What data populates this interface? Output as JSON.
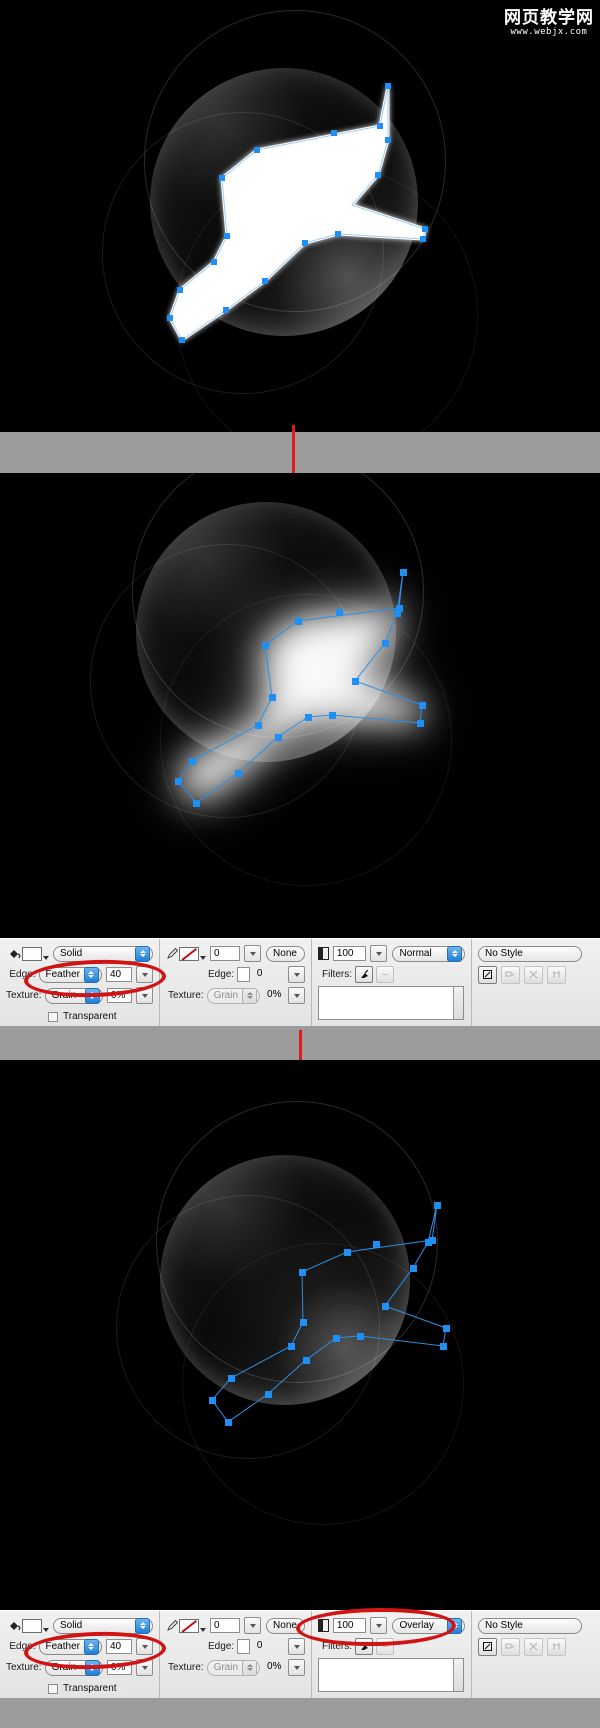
{
  "watermark": {
    "cn_text": "网页教学网",
    "url_text": "www.webjx.com"
  },
  "panels": {
    "step1": {
      "name": "sharp-vector-shape-on-sphere",
      "description": "White filled vector bird shape with blue anchor points over dark glossy sphere"
    },
    "step2": {
      "name": "feathered-shape-on-sphere",
      "description": "Same shape after 40 px feather edge applied"
    },
    "step3": {
      "name": "overlay-blend-shape-on-sphere",
      "description": "Shape set to Overlay blend mode at 100 opacity"
    }
  },
  "arrows": {
    "label": "down-arrow",
    "color": "#e01b1b"
  },
  "inspector_top": {
    "fill": {
      "color_swatch_label": "",
      "fill_type": "Solid",
      "edge_label": "Edge:",
      "edge_type": "Feather",
      "edge_amount": "40",
      "texture_label": "Texture:",
      "texture_type": "Grain",
      "texture_amount": "0%",
      "transparent_label": "Transparent"
    },
    "stroke": {
      "stroke_width": "0",
      "stroke_category": "None",
      "edge_label": "Edge:",
      "edge_amount": "0",
      "texture_label": "Texture:",
      "texture_type": "Grain",
      "texture_amount": "0%"
    },
    "effects": {
      "opacity": "100",
      "blend_mode": "Normal",
      "filters_label": "Filters:",
      "add_filter": "+",
      "remove_filter": "–"
    },
    "styles": {
      "style_name": "No Style"
    }
  },
  "inspector_bottom": {
    "fill": {
      "fill_type": "Solid",
      "edge_label": "Edge:",
      "edge_type": "Feather",
      "edge_amount": "40",
      "texture_label": "Texture:",
      "texture_type": "Grain",
      "texture_amount": "0%",
      "transparent_label": "Transparent"
    },
    "stroke": {
      "stroke_width": "0",
      "stroke_category": "None",
      "edge_label": "Edge:",
      "edge_amount": "0",
      "texture_label": "Texture:",
      "texture_type": "Grain",
      "texture_amount": "0%"
    },
    "effects": {
      "opacity": "100",
      "blend_mode": "Overlay",
      "filters_label": "Filters:",
      "add_filter": "+",
      "remove_filter": "–"
    },
    "styles": {
      "style_name": "No Style"
    }
  },
  "highlight": {
    "color": "#d01414",
    "shape": "red-ellipse-annotation"
  }
}
